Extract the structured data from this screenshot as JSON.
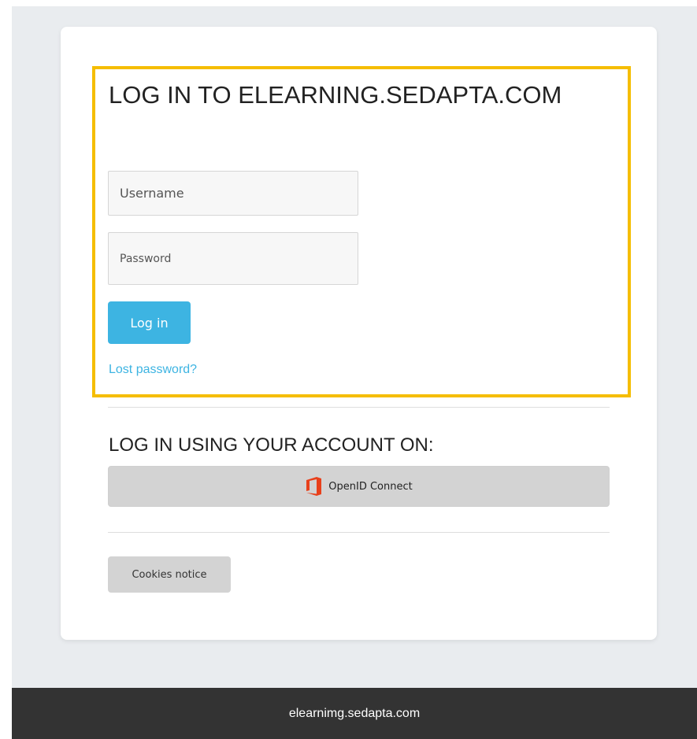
{
  "login": {
    "title": "LOG IN TO ELEARNING.SEDAPTA.COM",
    "username_placeholder": "Username",
    "password_placeholder": "Password",
    "login_label": "Log in",
    "lost_password_label": "Lost password?"
  },
  "external": {
    "title": "LOG IN USING YOUR ACCOUNT ON:",
    "openid_label": "OpenID Connect",
    "openid_icon": "office-icon"
  },
  "cookies_label": "Cookies notice",
  "footer": {
    "text": "elearnimg.sedapta.com"
  },
  "colors": {
    "accent": "#3db4e2",
    "highlight": "#f5bd00",
    "footer_bg": "#333333",
    "office_red": "#e8401b"
  }
}
